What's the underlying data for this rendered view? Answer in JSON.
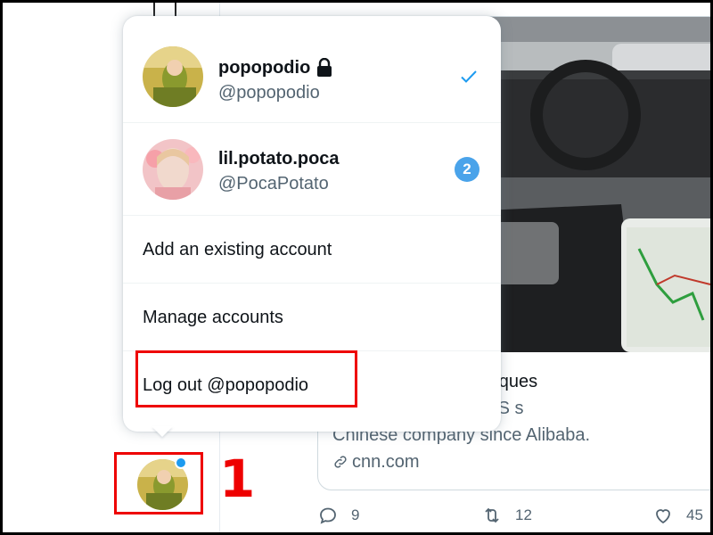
{
  "account_menu": {
    "accounts": [
      {
        "display_name": "popopodio",
        "handle": "@popopodio",
        "protected": true,
        "active": true
      },
      {
        "display_name": "lil.potato.poca",
        "handle": "@PocaPotato",
        "notification_count": "2"
      }
    ],
    "add_account_label": "Add an existing account",
    "manage_accounts_label": "Manage accounts",
    "logout_label": "Log out @popopodio"
  },
  "tweet_card": {
    "title_line": "ockbuster US IPO in ques",
    "description_line1": "ublic in the biggest US s",
    "description_line2": "Chinese company since Alibaba.",
    "link_domain": "cnn.com"
  },
  "actions": {
    "reply_count": "9",
    "retweet_count": "12",
    "like_count": "45"
  },
  "annotations": {
    "step1": "1",
    "step2": "2"
  },
  "icons": [
    "lock-icon",
    "checkmark-icon",
    "link-icon",
    "reply-icon",
    "retweet-icon",
    "like-icon"
  ],
  "colors": {
    "accent": "#1d9bf0",
    "annotation_red": "#e00000",
    "secondary_text": "#536471"
  }
}
